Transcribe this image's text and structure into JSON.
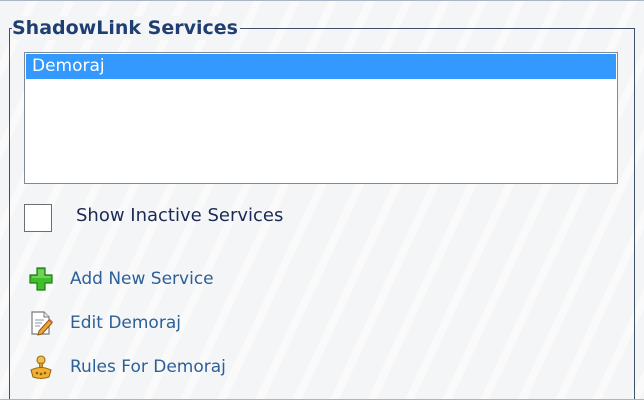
{
  "panel": {
    "title": "ShadowLink Services"
  },
  "services_list": {
    "items": [
      "Demoraj"
    ],
    "selected": "Demoraj"
  },
  "show_inactive": {
    "label": "Show Inactive Services",
    "checked": false
  },
  "actions": [
    {
      "label": "Add New Service",
      "icon": "plus-icon"
    },
    {
      "label": "Edit Demoraj",
      "icon": "edit-document-icon"
    },
    {
      "label": "Rules For Demoraj",
      "icon": "rules-icon"
    }
  ],
  "colors": {
    "selection": "#3399ff",
    "title": "#1f3f73",
    "link": "#2c5f98",
    "plus_icon": "#3fbf2a"
  }
}
